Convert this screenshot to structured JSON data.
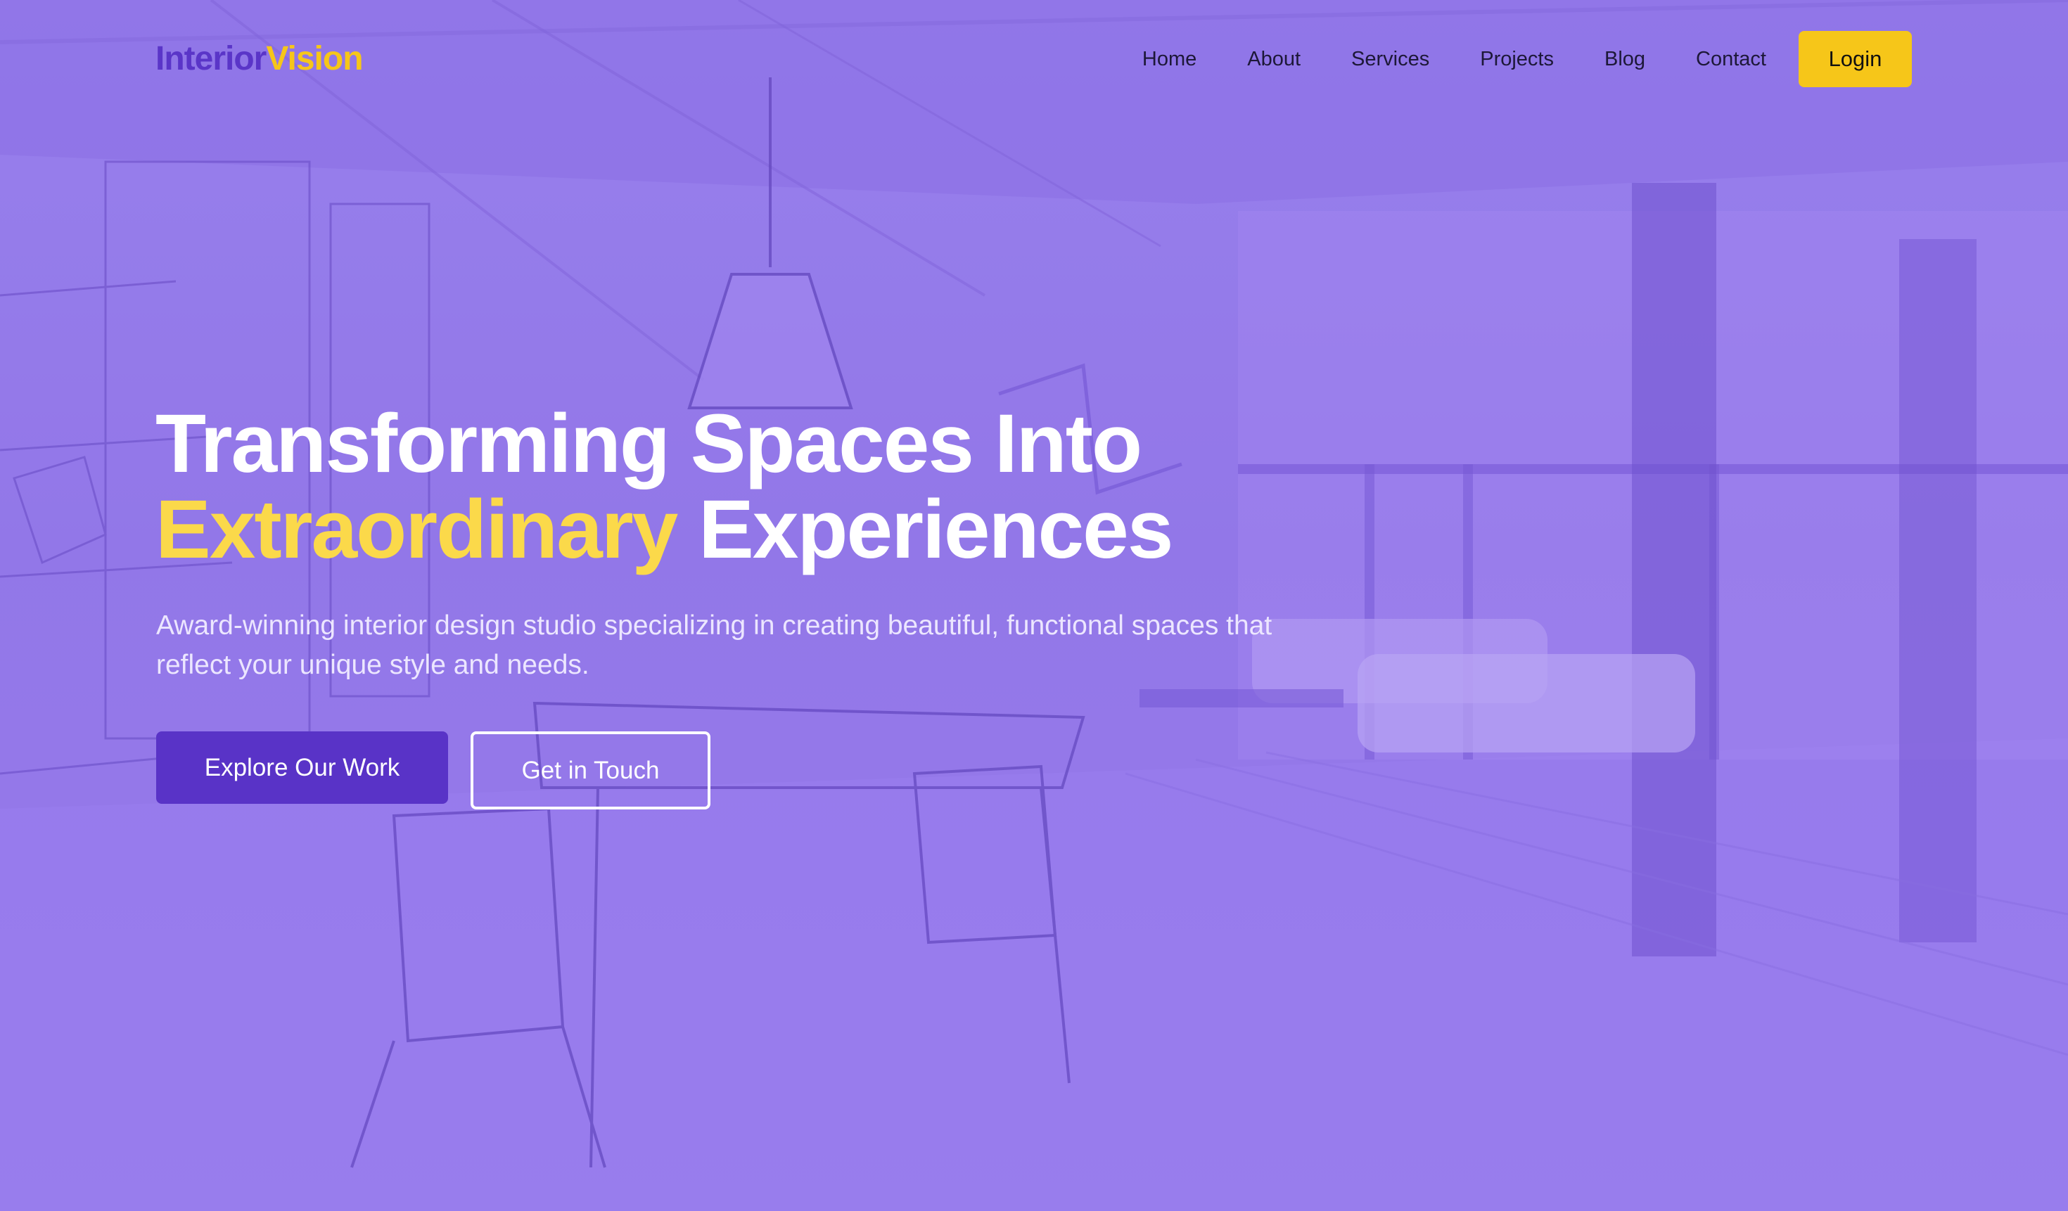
{
  "brand": {
    "part1": "Interior",
    "part2": "Vision"
  },
  "nav": {
    "items": [
      {
        "label": "Home"
      },
      {
        "label": "About"
      },
      {
        "label": "Services"
      },
      {
        "label": "Projects"
      },
      {
        "label": "Blog"
      },
      {
        "label": "Contact"
      }
    ],
    "login_label": "Login"
  },
  "hero": {
    "headline_line1": "Transforming Spaces Into",
    "headline_accent": "Extraordinary",
    "headline_rest": "Experiences",
    "subtitle": "Award-winning interior design studio specializing in creating beautiful, functional spaces that reflect your unique style and needs.",
    "primary_cta": "Explore Our Work",
    "secondary_cta": "Get in Touch"
  },
  "colors": {
    "brand_primary": "#5a35c8",
    "brand_accent": "#f6c619",
    "overlay": "#9a82ec",
    "headline_accent": "#fbd94a"
  }
}
